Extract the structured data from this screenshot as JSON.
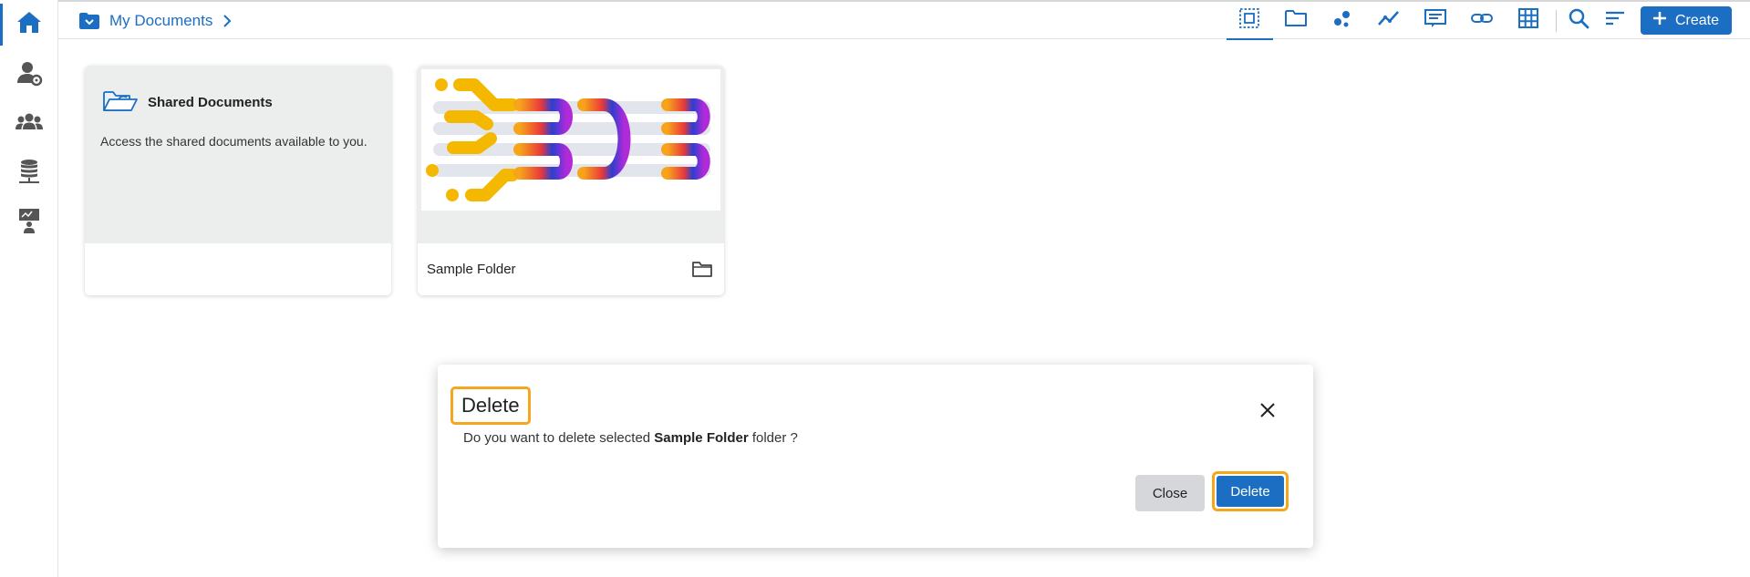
{
  "breadcrumb": {
    "label": "My Documents"
  },
  "toolbar": {
    "create_label": "Create"
  },
  "cards": [
    {
      "title": "Shared Documents",
      "description": "Access the shared documents available to you."
    },
    {
      "name": "Sample Folder"
    }
  ],
  "modal": {
    "title": "Delete",
    "message_prefix": "Do you want to delete selected ",
    "message_bold": "Sample Folder",
    "message_suffix": " folder ?",
    "close_label": "Close",
    "delete_label": "Delete"
  },
  "colors": {
    "accent": "#1b6ec2",
    "highlight": "#f4a61c"
  },
  "icons": [
    "home-icon",
    "user-settings-icon",
    "users-icon",
    "database-icon",
    "presentation-icon",
    "select-all-icon",
    "folder-icon",
    "scatter-icon",
    "line-chart-icon",
    "message-icon",
    "link-icon",
    "grid-icon",
    "search-icon",
    "sort-icon",
    "plus-icon"
  ]
}
